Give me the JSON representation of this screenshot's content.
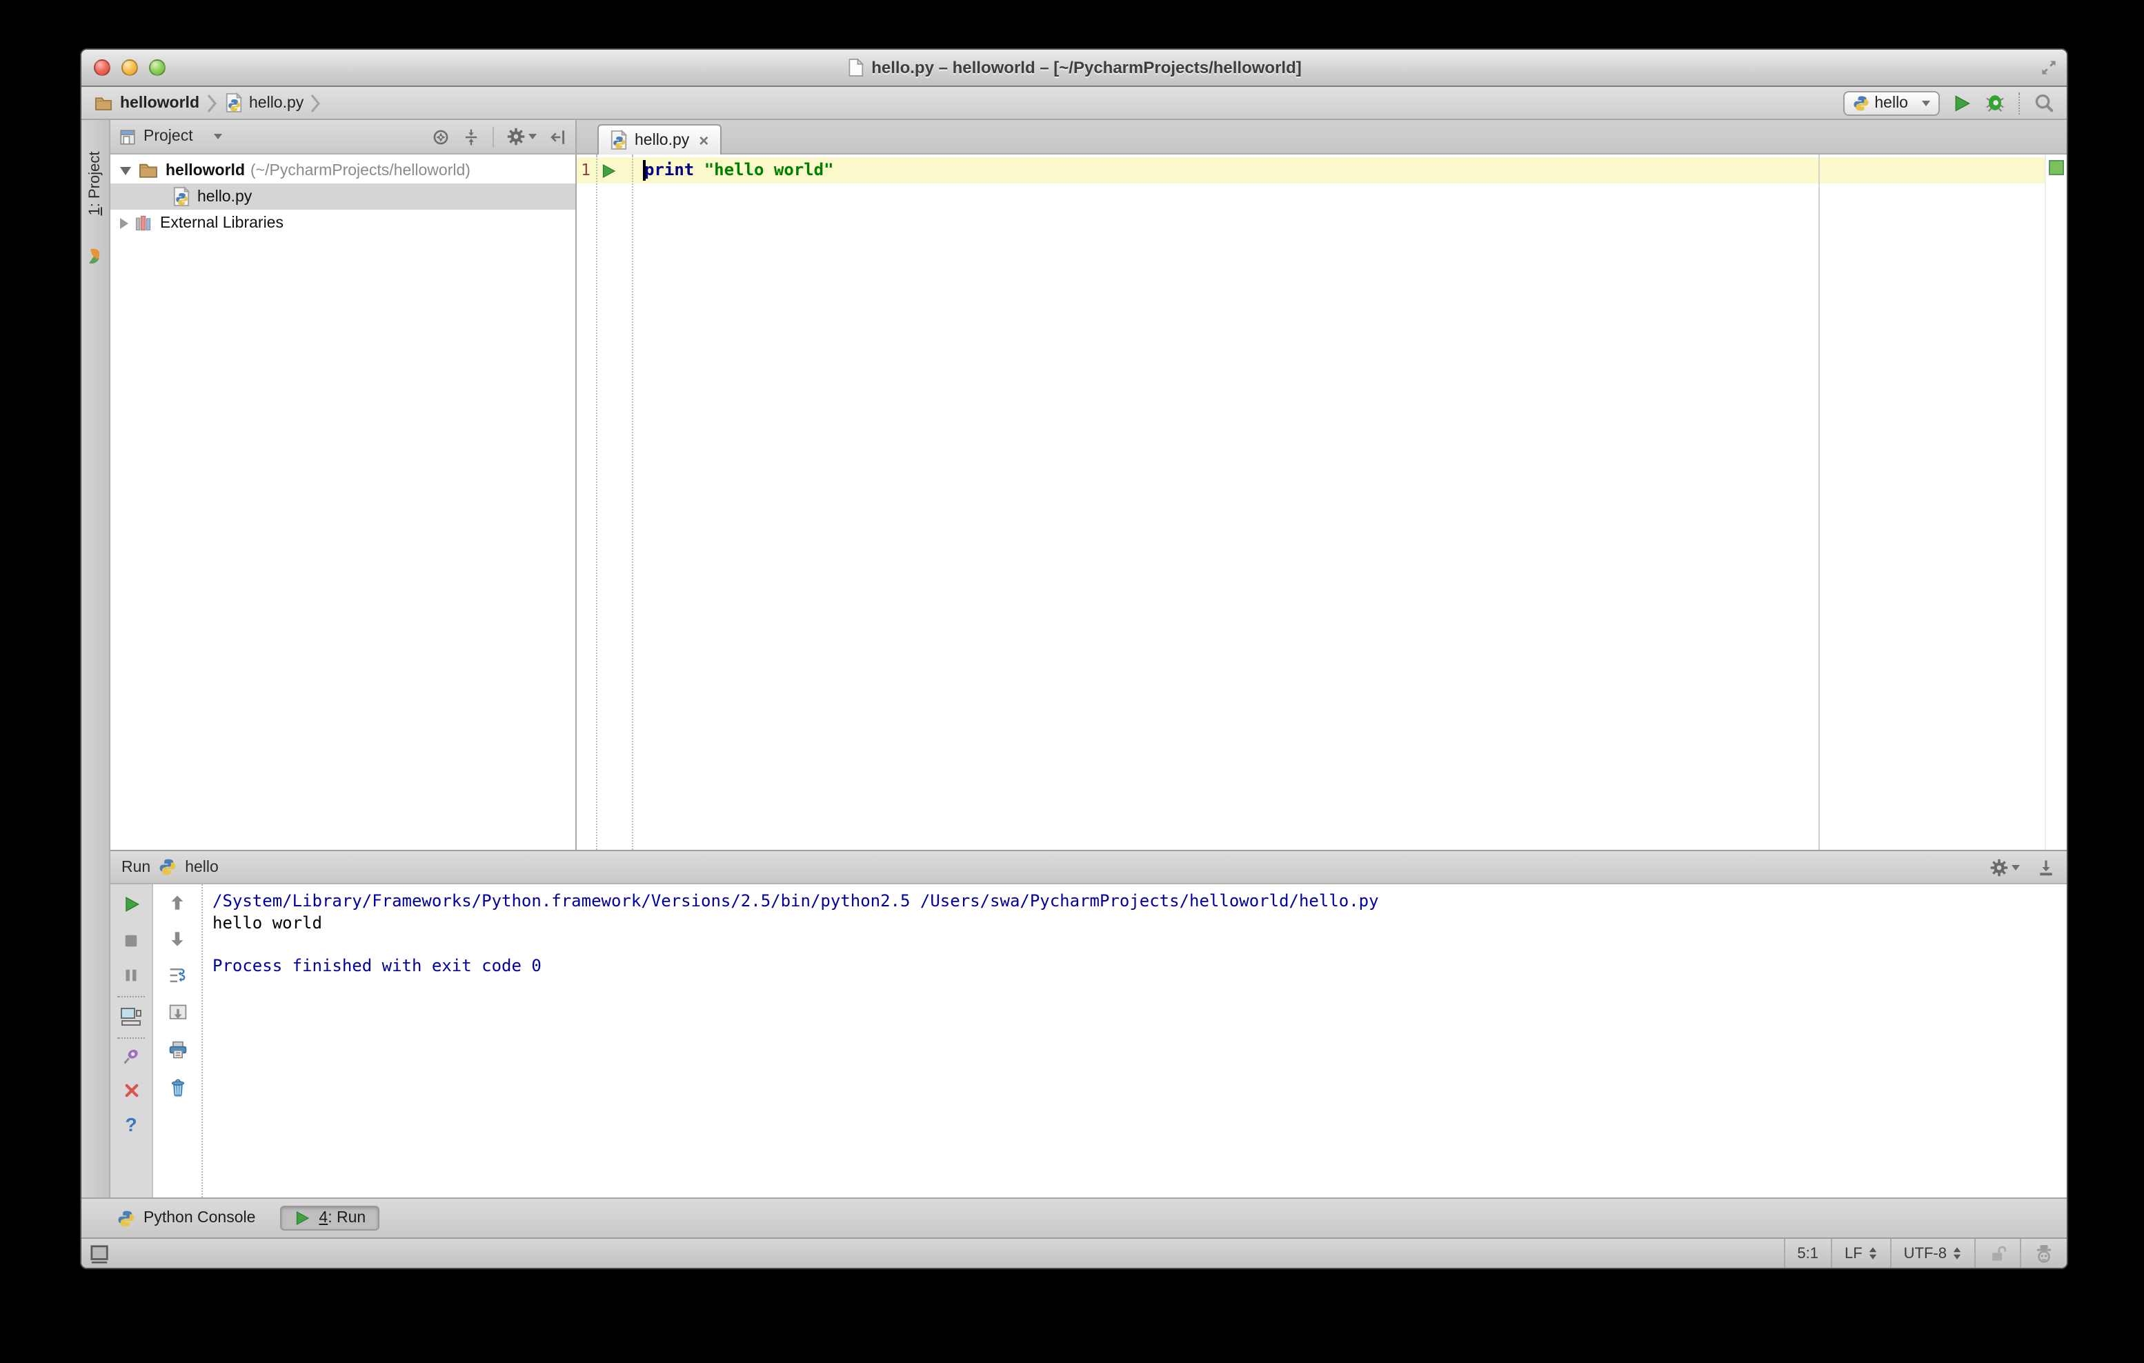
{
  "window": {
    "title": "hello.py – helloworld – [~/PycharmProjects/helloworld]"
  },
  "navbar": {
    "breadcrumb": {
      "project": "helloworld",
      "file": "hello.py"
    },
    "run_config": "hello"
  },
  "tool_stripe": {
    "mnemonic": "1",
    "rest": ": Project"
  },
  "project_panel": {
    "title": "Project",
    "tree": {
      "root": {
        "name": "helloworld",
        "path": "(~/PycharmProjects/helloworld)"
      },
      "file": {
        "name": "hello.py"
      },
      "libs": {
        "name": "External Libraries"
      }
    }
  },
  "editor": {
    "tab": {
      "title": "hello.py",
      "close": "×"
    },
    "line1": {
      "number": "1",
      "keyword": "print",
      "sep": " ",
      "string": "\"hello world\""
    }
  },
  "run_panel": {
    "title": "Run",
    "config": "hello",
    "console": {
      "line1": "/System/Library/Frameworks/Python.framework/Versions/2.5/bin/python2.5 /Users/swa/PycharmProjects/helloworld/hello.py",
      "line2": "hello world",
      "line3": "",
      "line4": "Process finished with exit code 0"
    },
    "help_glyph": "?"
  },
  "bottom_bar": {
    "python_console": "Python Console",
    "run_mnemonic": "4",
    "run_rest": ": Run"
  },
  "status_bar": {
    "caret": "5:1",
    "line_sep": "LF",
    "encoding": "UTF-8"
  },
  "icons": {
    "traffic": [
      "close",
      "minimize",
      "zoom"
    ],
    "navbar": [
      "folder-icon",
      "chevron-right-icon",
      "python-file-icon",
      "run-icon",
      "debug-bug-icon",
      "search-icon"
    ],
    "project_header": [
      "project-view-icon",
      "locate-icon",
      "collapse-all-icon",
      "settings-gear-icon",
      "hide-panel-icon"
    ],
    "console_toolbar_left": [
      "rerun-icon",
      "stop-icon",
      "pause-icon",
      "show-console-icon",
      "pin-icon",
      "close-icon",
      "help-icon"
    ],
    "console_toolbar_right": [
      "up-stack-icon",
      "down-stack-icon",
      "soft-wrap-icon",
      "scroll-to-end-icon",
      "print-icon",
      "clear-all-icon"
    ],
    "status": [
      "toolwindow-toggle-icon",
      "unlock-icon",
      "hector-inspector-icon"
    ]
  },
  "colors": {
    "keyword": "#000080",
    "string": "#008000",
    "console_system": "#00009e",
    "current_line": "#fbf8cb",
    "selection": "#d5d5d5",
    "run_green": "#3fa33f"
  }
}
